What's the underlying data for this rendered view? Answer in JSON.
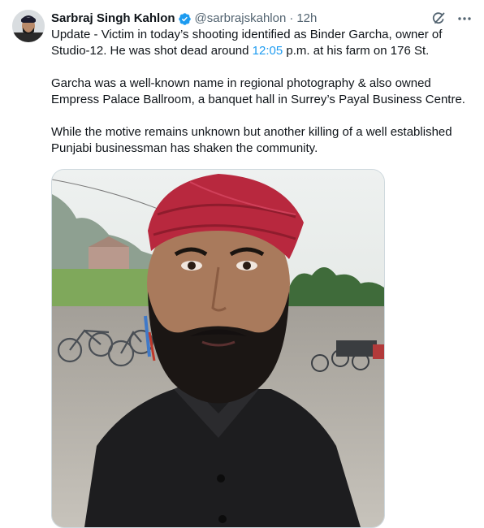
{
  "tweet": {
    "author": {
      "display_name": "Sarbraj Singh Kahlon",
      "handle": "@sarbrajskahlon",
      "verified": true
    },
    "separator": "·",
    "timestamp": "12h",
    "text": {
      "p1_before": "Update - Victim in today’s shooting identified as Binder Garcha, owner of Studio-12. He was shot dead around ",
      "p1_link": "12:05",
      "p1_after": " p.m. at his farm on 176 St.",
      "p2": "Garcha was a well-known name in regional photography & also owned Empress Palace Ballroom, a banquet hall in Surrey’s Payal Business Centre.",
      "p3": "While the motive remains unknown but another killing of a well established Punjabi businessman has shaken the community."
    },
    "icons": {
      "verified": "verified-badge-icon",
      "grok": "grok-icon",
      "more": "more-options-icon"
    }
  },
  "colors": {
    "text_primary": "#0f1419",
    "text_secondary": "#536471",
    "link": "#1d9bf0",
    "verified": "#1d9bf0",
    "border": "#cfd9de"
  }
}
